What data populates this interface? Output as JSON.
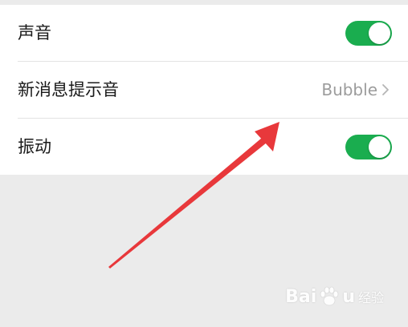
{
  "settings": {
    "rows": [
      {
        "label": "声音",
        "control": "toggle",
        "toggle_on": true
      },
      {
        "label": "新消息提示音",
        "control": "value",
        "value": "Bubble"
      },
      {
        "label": "振动",
        "control": "toggle",
        "toggle_on": true
      }
    ]
  },
  "watermark": {
    "left_text": "Bai",
    "right_text": "u",
    "sub_text": "经验"
  },
  "colors": {
    "toggle_on": "#1aad4f",
    "arrow": "#e8383b",
    "background": "#ebebeb",
    "row_background": "#ffffff",
    "value_text": "#9c9c9c"
  },
  "icons": {
    "chevron": "chevron-right-icon",
    "watermark_logo": "paw-icon",
    "annotation": "red-arrow-annotation"
  }
}
